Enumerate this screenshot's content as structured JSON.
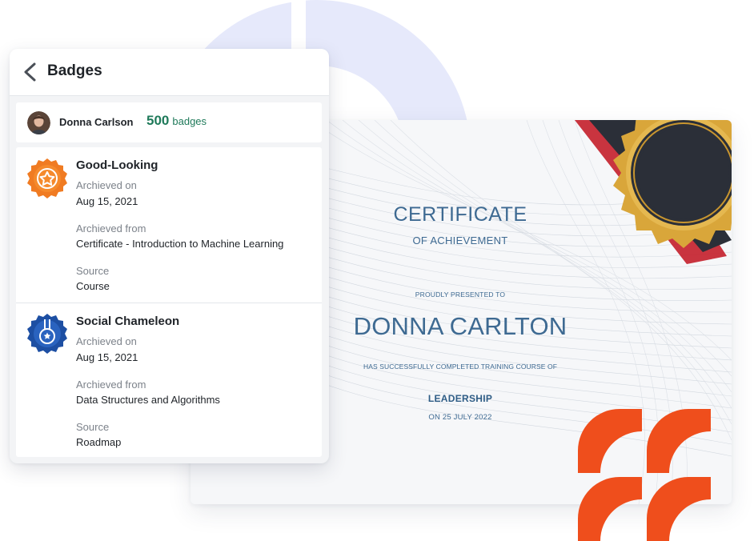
{
  "panel": {
    "title": "Badges",
    "user": {
      "name": "Donna Carlson",
      "badge_count": "500",
      "badge_unit": "badges"
    },
    "badges": [
      {
        "name": "Good-Looking",
        "icon": "star-medal-icon",
        "color": "#f07b22",
        "archived_on_label": "Archieved on",
        "archived_on": "Aug 15, 2021",
        "archived_from_label": "Archieved from",
        "archived_from": "Certificate - Introduction to Machine Learning",
        "source_label": "Source",
        "source": "Course"
      },
      {
        "name": "Social Chameleon",
        "icon": "shield-medal-icon",
        "color": "#1d4fa3",
        "archived_on_label": "Archieved on",
        "archived_on": "Aug 15, 2021",
        "archived_from_label": "Archieved from",
        "archived_from": "Data Structures and Algorithms",
        "source_label": "Source",
        "source": "Roadmap"
      }
    ]
  },
  "certificate": {
    "title": "CERTIFICATE",
    "subtitle": "OF ACHIEVEMENT",
    "presented_to": "PROUDLY PRESENTED TO",
    "recipient": "DONNA CARLTON",
    "completed_text": "HAS SUCCESSFULLY COMPLETED TRAINING COURSE OF",
    "course": "LEADERSHIP",
    "date": "ON 25 JULY 2022"
  },
  "colors": {
    "accent_green": "#1f7a5a",
    "certificate_blue": "#3e6a92",
    "orange_accent": "#ef4e1c",
    "seal_gold": "#d9a63a",
    "seal_dark": "#2b2f38",
    "background_circle": "#e6e9fb"
  }
}
